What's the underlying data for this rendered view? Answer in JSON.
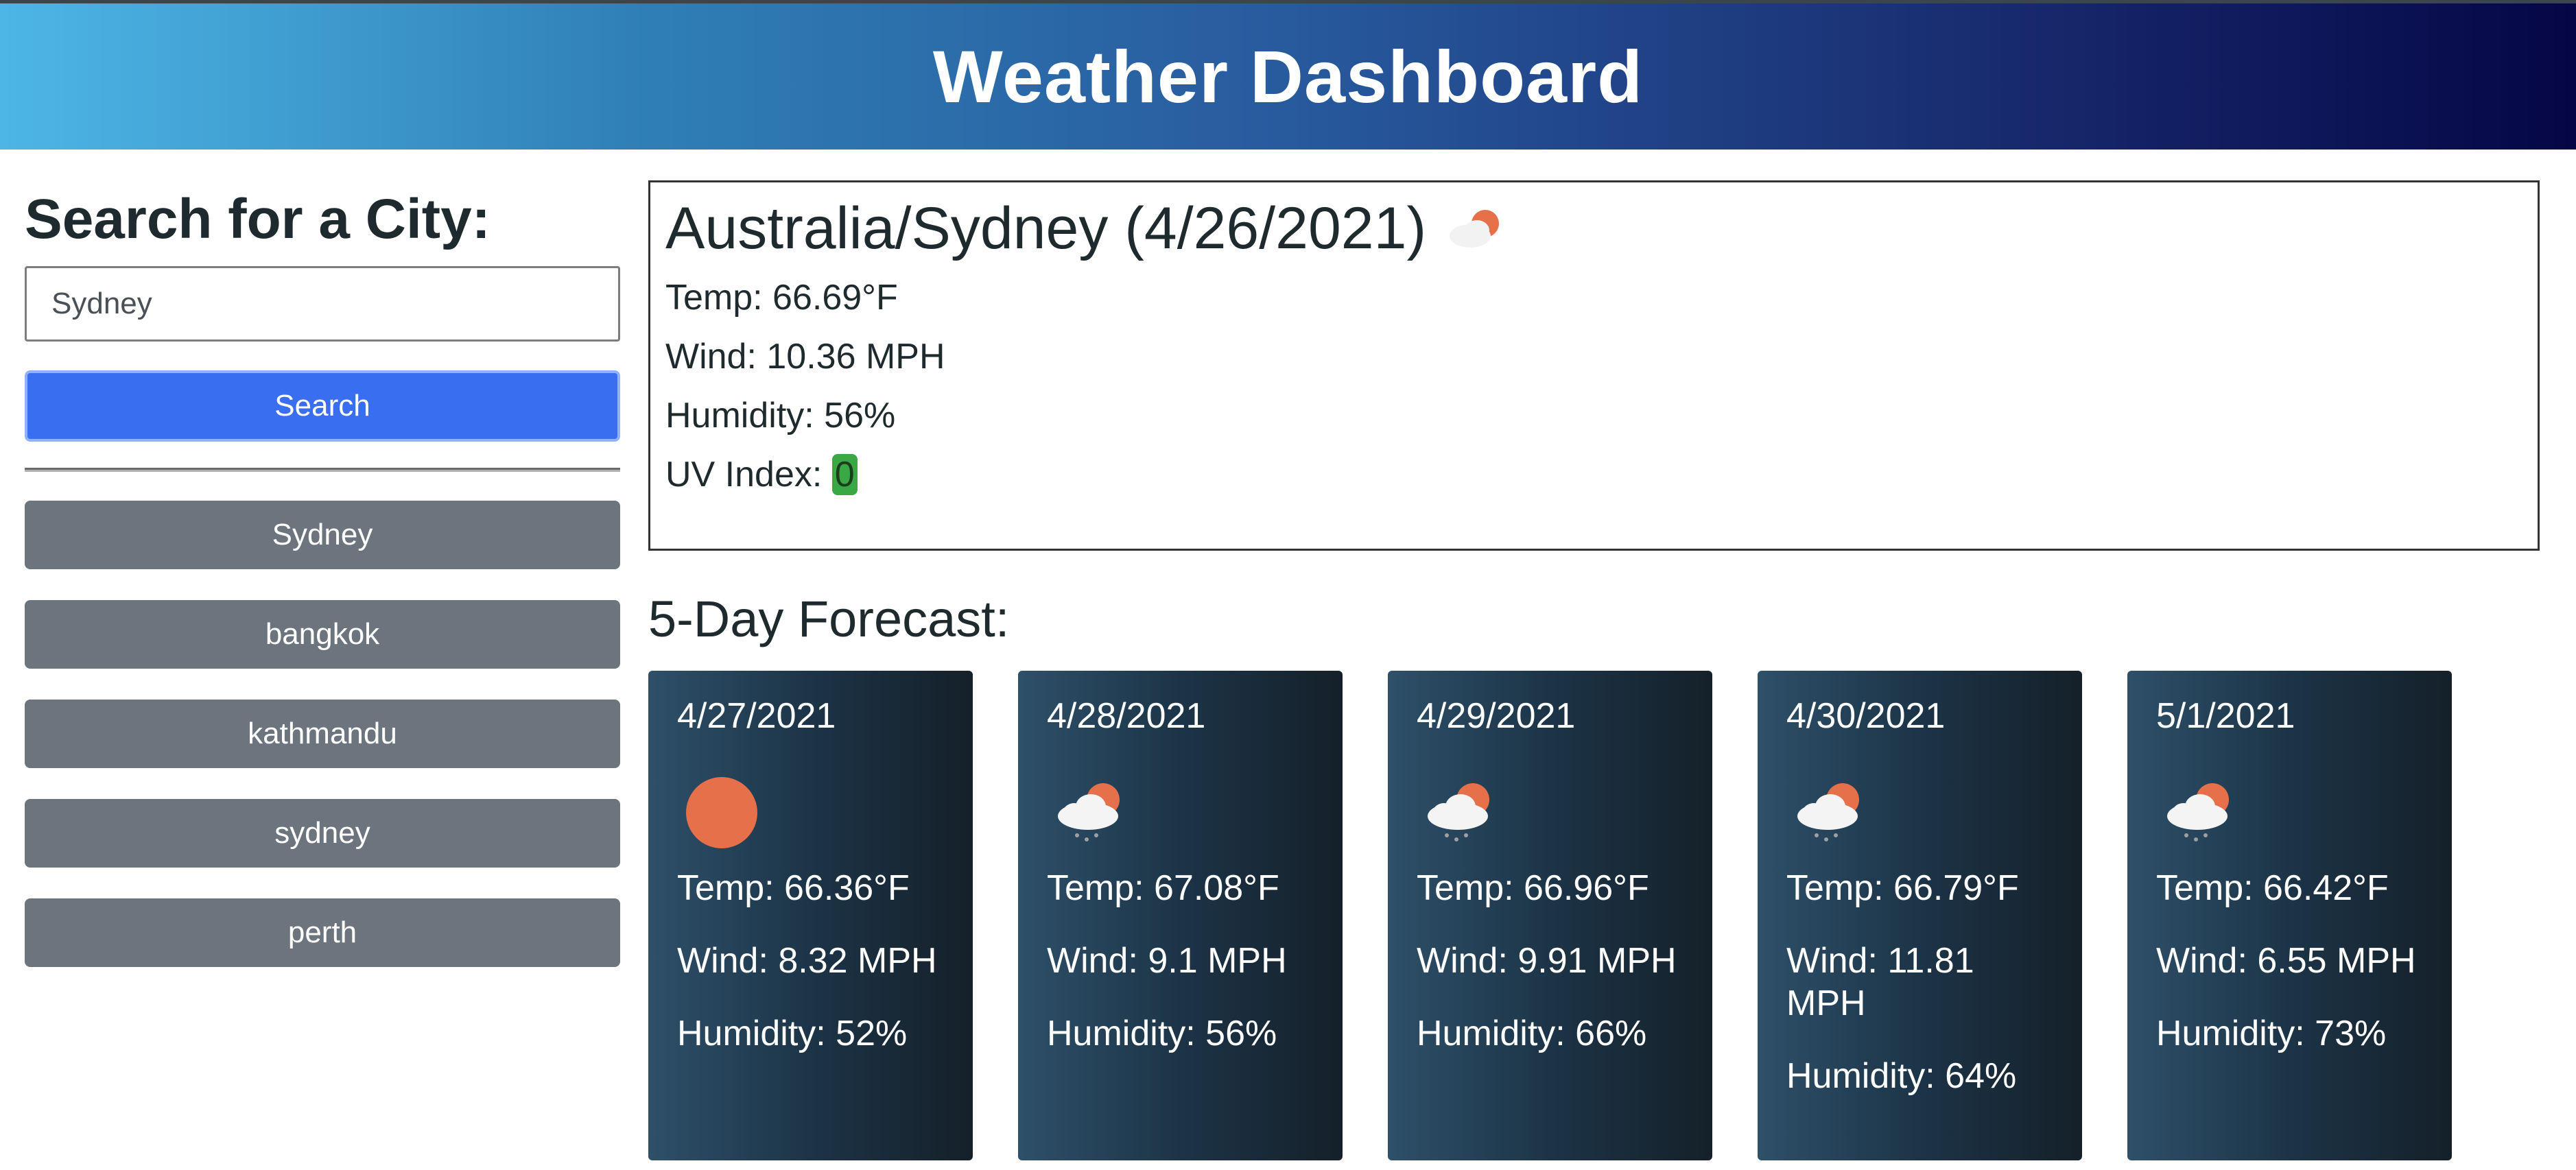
{
  "header": {
    "title": "Weather Dashboard"
  },
  "search": {
    "heading": "Search for a City:",
    "value": "Sydney",
    "placeholder": "",
    "button_label": "Search"
  },
  "history": [
    "Sydney",
    "bangkok",
    "kathmandu",
    "sydney",
    "perth"
  ],
  "current": {
    "title": "Australia/Sydney (4/26/2021)",
    "icon": "few-clouds-day-icon",
    "temp": "Temp: 66.69°F",
    "wind": "Wind: 10.36 MPH",
    "humidity": "Humidity: 56%",
    "uv_label": "UV Index:",
    "uv_value": "0",
    "uv_color": "#3aa845"
  },
  "forecast": {
    "heading": "5-Day Forecast:",
    "days": [
      {
        "date": "4/27/2021",
        "icon": "sun-icon",
        "temp": "Temp: 66.36°F",
        "wind": "Wind: 8.32 MPH",
        "humidity": "Humidity: 52%"
      },
      {
        "date": "4/28/2021",
        "icon": "rain-cloud-sun-icon",
        "temp": "Temp: 67.08°F",
        "wind": "Wind: 9.1 MPH",
        "humidity": "Humidity: 56%"
      },
      {
        "date": "4/29/2021",
        "icon": "rain-cloud-sun-icon",
        "temp": "Temp: 66.96°F",
        "wind": "Wind: 9.91 MPH",
        "humidity": "Humidity: 66%"
      },
      {
        "date": "4/30/2021",
        "icon": "rain-cloud-sun-icon",
        "temp": "Temp: 66.79°F",
        "wind": "Wind: 11.81 MPH",
        "humidity": "Humidity: 64%"
      },
      {
        "date": "5/1/2021",
        "icon": "rain-cloud-sun-icon",
        "temp": "Temp: 66.42°F",
        "wind": "Wind: 6.55 MPH",
        "humidity": "Humidity: 73%"
      }
    ]
  },
  "colors": {
    "header_gradient_start": "#4db6e6",
    "header_gradient_end": "#050646",
    "search_button": "#3a6ef0",
    "history_button": "#6c757d",
    "card_background": "#1c3447",
    "sun": "#e5704a"
  }
}
